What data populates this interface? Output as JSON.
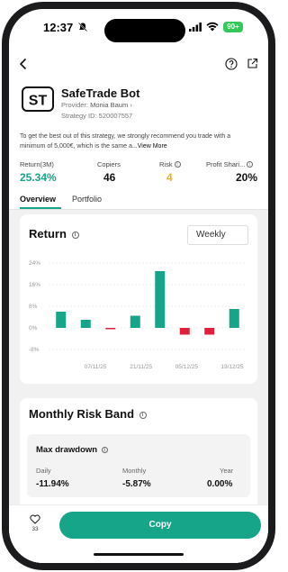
{
  "status_bar": {
    "time": "12:37",
    "battery": "90+"
  },
  "bot": {
    "name": "SafeTrade Bot",
    "logo_text": "ST",
    "provider_label": "Provider: ",
    "provider_name": "Monia Baum",
    "provider_chevron": "›",
    "strategy_id": "Strategy ID: 520007557"
  },
  "description": {
    "text": "To get the best out of this strategy, we strongly recommend you trade with a minimum of 5,000€, which is the same a...",
    "more": "View More"
  },
  "stats": [
    {
      "label": "Return(3M)",
      "value": "25.34%",
      "color": "#17a58a",
      "has_info": false
    },
    {
      "label": "Copiers",
      "value": "46",
      "color": "#111111",
      "has_info": false
    },
    {
      "label": "Risk",
      "value": "4",
      "color": "#f2b01e",
      "has_info": true
    },
    {
      "label": "Profit Shari...",
      "value": "20%",
      "color": "#111111",
      "has_info": true
    }
  ],
  "tabs": [
    {
      "label": "Overview",
      "active": true
    },
    {
      "label": "Portfolio",
      "active": false
    }
  ],
  "return_card": {
    "title": "Return",
    "period": "Weekly"
  },
  "chart_data": {
    "type": "bar",
    "y_ticks": [
      "24%",
      "16%",
      "8%",
      "0%",
      "-8%"
    ],
    "ylim": [
      -8,
      24
    ],
    "x_ticks": [
      "07/11/25",
      "21/11/25",
      "05/12/25",
      "19/12/25"
    ],
    "values": [
      6,
      3,
      -0.5,
      4.5,
      21,
      -2.5,
      -2.5,
      7
    ],
    "positive_color": "#17a58a",
    "negative_color": "#e0203c"
  },
  "risk_card": {
    "title": "Monthly Risk Band",
    "max_drawdown": {
      "title": "Max drawdown",
      "items": [
        {
          "label": "Daily",
          "value": "-11.94%"
        },
        {
          "label": "Monthly",
          "value": "-5.87%"
        },
        {
          "label": "Year",
          "value": "0.00%"
        }
      ]
    }
  },
  "bottom_bar": {
    "likes": "33",
    "copy_label": "Copy"
  },
  "colors": {
    "accent": "#17a58a"
  }
}
